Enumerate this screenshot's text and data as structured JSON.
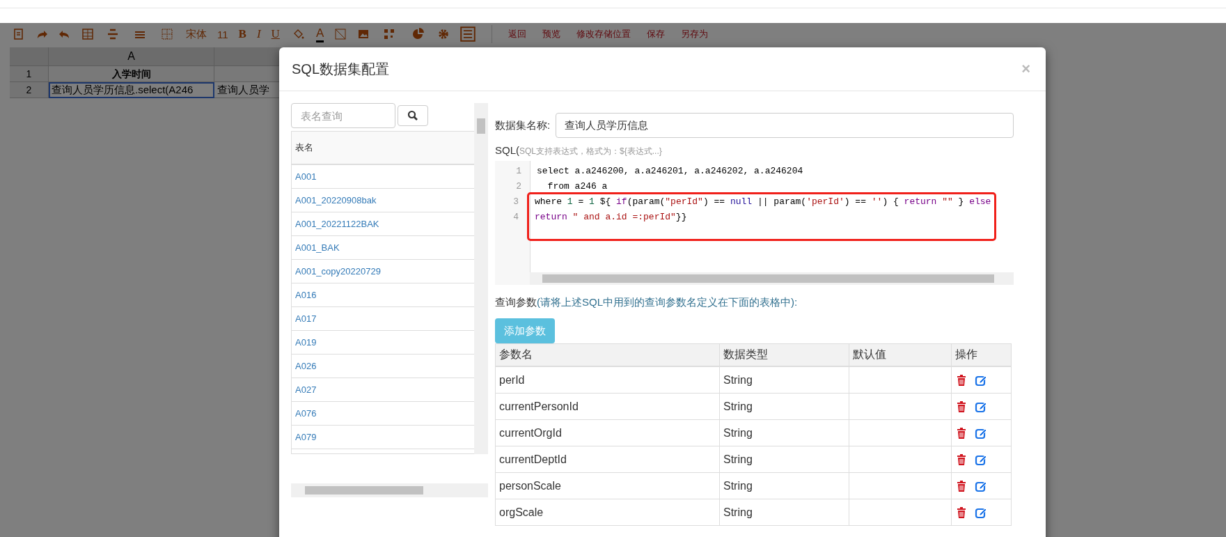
{
  "toolbar": {
    "font": "宋体",
    "size": "11",
    "styles": [
      "B",
      "I",
      "U"
    ],
    "color_glyph": "A",
    "links": [
      "返回",
      "预览",
      "修改存储位置",
      "保存",
      "另存为"
    ]
  },
  "sheet": {
    "columns": [
      "A"
    ],
    "row_numbers": [
      "1",
      "2"
    ],
    "rows": [
      [
        "入学时间"
      ],
      [
        "查询人员学历信息.select(A246",
        "查询人员学"
      ]
    ]
  },
  "dialog": {
    "title": "SQL数据集配置",
    "close": "×",
    "tables": {
      "search_placeholder": "表名查询",
      "header": "表名",
      "items": [
        "A001",
        "A001_20220908bak",
        "A001_20221122BAK",
        "A001_BAK",
        "A001_copy20220729",
        "A016",
        "A017",
        "A019",
        "A026",
        "A027",
        "A076",
        "A079"
      ]
    },
    "name_label": "数据集名称:",
    "name_value": "查询人员学历信息",
    "sql_label": "SQL(",
    "sql_hint": "SQL支持表达式，格式为：${表达式...}",
    "code": [
      {
        "number": "1",
        "highlighted": false,
        "tokens": [
          {
            "kind": "plain",
            "text": "select a.a246200, a.a246201, a.a246202, a.a246204"
          }
        ]
      },
      {
        "number": "2",
        "highlighted": false,
        "tokens": [
          {
            "kind": "plain",
            "text": "  from a246 a"
          }
        ]
      },
      {
        "number": "3",
        "highlighted": true,
        "tokens": [
          {
            "kind": "plain",
            "text": "where "
          },
          {
            "kind": "num",
            "text": "1"
          },
          {
            "kind": "plain",
            "text": " = "
          },
          {
            "kind": "num",
            "text": "1"
          },
          {
            "kind": "plain",
            "text": " ${ "
          },
          {
            "kind": "kw",
            "text": "if"
          },
          {
            "kind": "plain",
            "text": "(param("
          },
          {
            "kind": "str",
            "text": "\"perId\""
          },
          {
            "kind": "plain",
            "text": ") == "
          },
          {
            "kind": "atom",
            "text": "null"
          },
          {
            "kind": "plain",
            "text": " || param("
          },
          {
            "kind": "str",
            "text": "'perId'"
          },
          {
            "kind": "plain",
            "text": ") == "
          },
          {
            "kind": "str",
            "text": "''"
          },
          {
            "kind": "plain",
            "text": ") { "
          },
          {
            "kind": "kw",
            "text": "return"
          },
          {
            "kind": "str",
            "text": " \"\""
          },
          {
            "kind": "plain",
            "text": " } "
          },
          {
            "kind": "kw",
            "text": "else"
          }
        ]
      },
      {
        "number": "4",
        "highlighted": true,
        "tokens": [
          {
            "kind": "kw",
            "text": "return"
          },
          {
            "kind": "str",
            "text": " \" and a.id =:perId\""
          },
          {
            "kind": "plain",
            "text": "}}"
          }
        ]
      }
    ],
    "params_label": "查询参数",
    "params_hint": "(请将上述SQL中用到的查询参数名定义在下面的表格中):",
    "add_button": "添加参数",
    "params": {
      "columns": [
        "参数名",
        "数据类型",
        "默认值",
        "操作"
      ],
      "rows": [
        {
          "name": "perId",
          "type": "String"
        },
        {
          "name": "currentPersonId",
          "type": "String"
        },
        {
          "name": "currentOrgId",
          "type": "String"
        },
        {
          "name": "currentDeptId",
          "type": "String"
        },
        {
          "name": "personScale",
          "type": "String"
        },
        {
          "name": "orgScale",
          "type": "String"
        }
      ]
    }
  }
}
